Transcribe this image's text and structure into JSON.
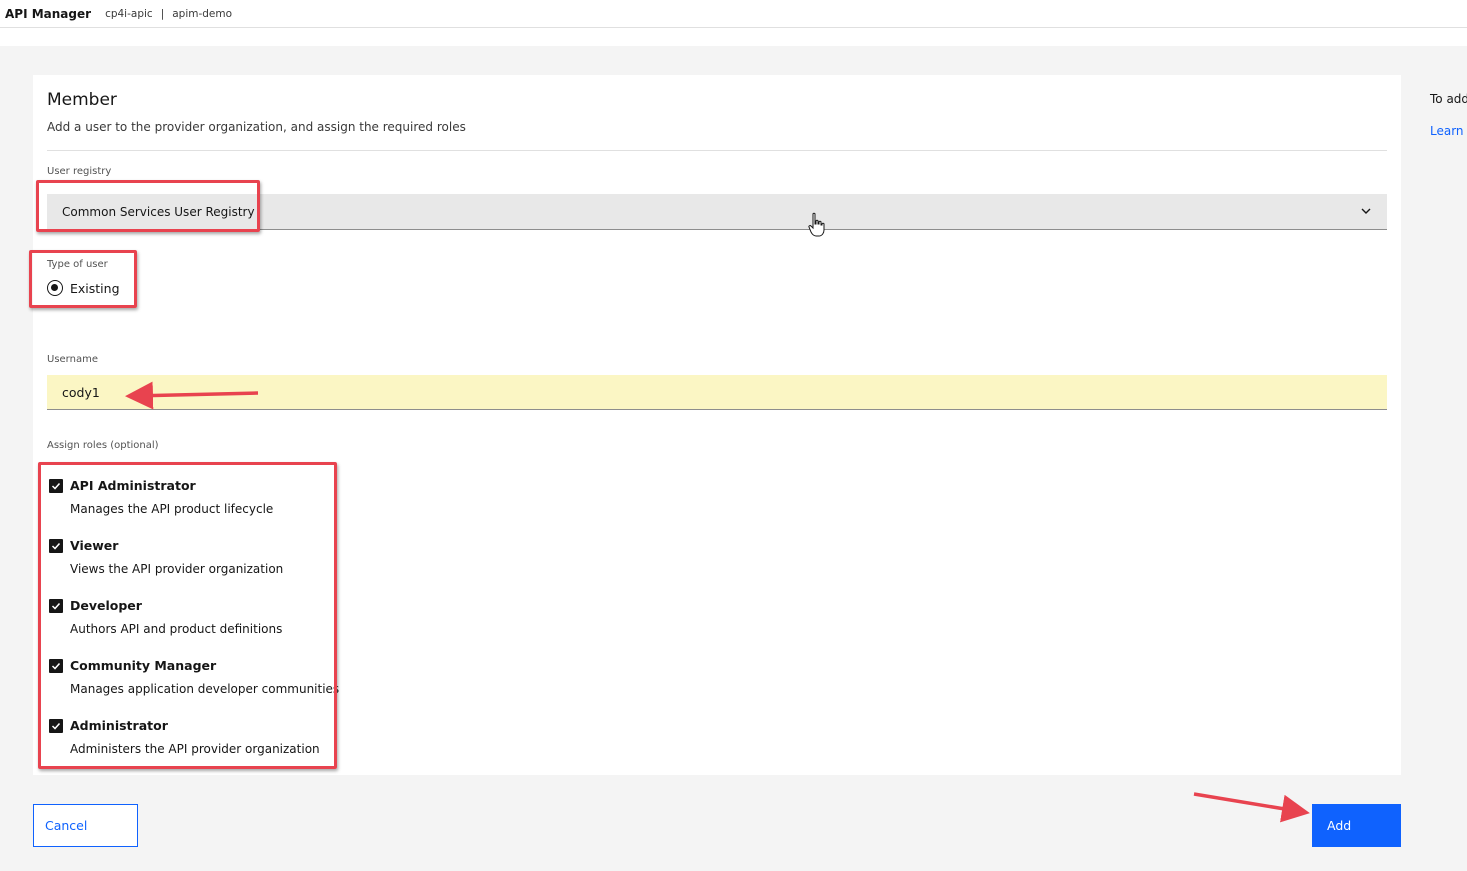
{
  "header": {
    "app_title": "API Manager",
    "cluster": "cp4i-apic",
    "separator": "|",
    "org": "apim-demo"
  },
  "form": {
    "title": "Member",
    "subtitle": "Add a user to the provider organization, and assign the required roles",
    "user_registry_label": "User registry",
    "user_registry_value": "Common Services User Registry",
    "user_type_label": "Type of user",
    "user_type_option": "Existing",
    "username_label": "Username",
    "username_value": "cody1",
    "roles_label": "Assign roles (optional)",
    "roles": [
      {
        "name": "API Administrator",
        "description": "Manages the API product lifecycle",
        "checked": true
      },
      {
        "name": "Viewer",
        "description": "Views the API provider organization",
        "checked": true
      },
      {
        "name": "Developer",
        "description": "Authors API and product definitions",
        "checked": true
      },
      {
        "name": "Community Manager",
        "description": "Manages application developer communities",
        "checked": true
      },
      {
        "name": "Administrator",
        "description": "Administers the API provider organization",
        "checked": true
      }
    ]
  },
  "actions": {
    "cancel_label": "Cancel",
    "add_label": "Add"
  },
  "side_panel": {
    "text": "To add",
    "link": "Learn r"
  },
  "icons": {
    "dropdown": "chevron-down-icon",
    "cursor": "hand-pointer-icon",
    "checkbox": "checkmark-icon"
  },
  "colors": {
    "primary": "#0f62fe",
    "annotation": "#e8434f",
    "input_highlight": "#fbf6c4"
  }
}
